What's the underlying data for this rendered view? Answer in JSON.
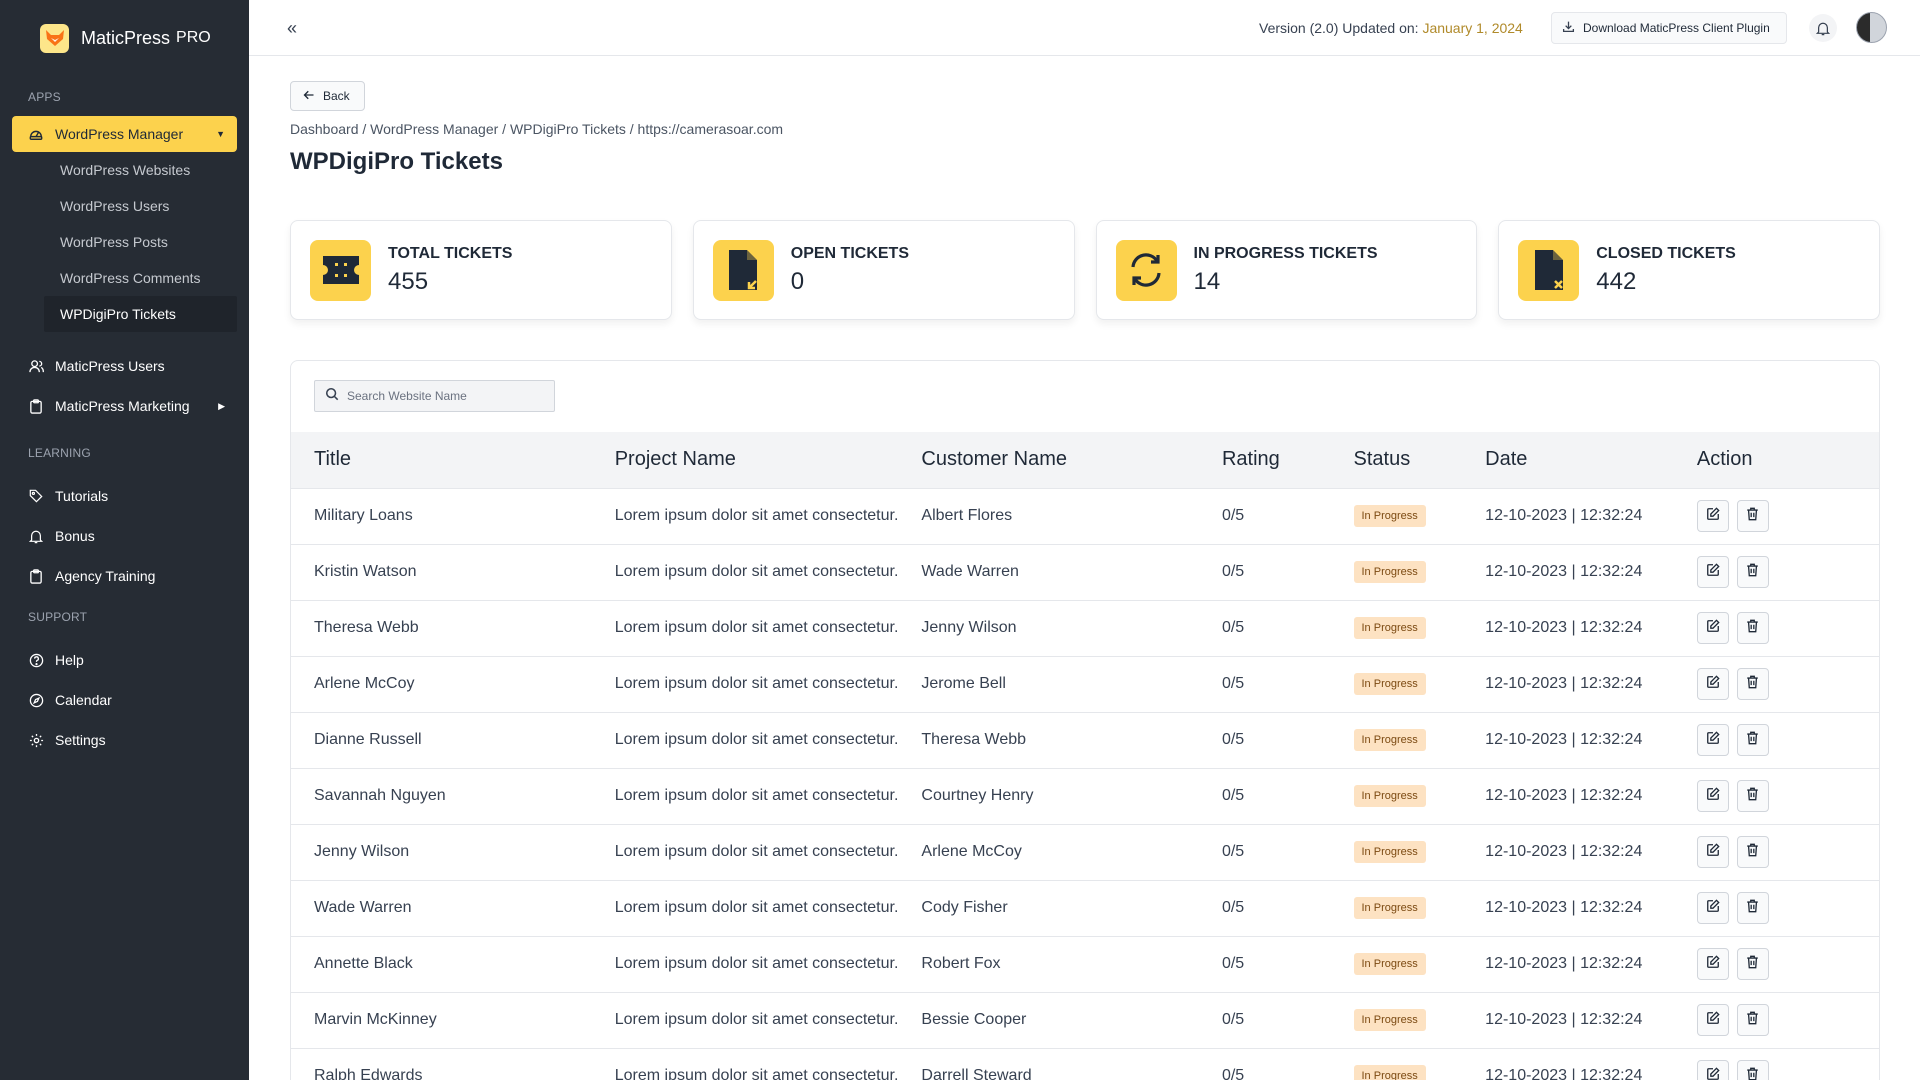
{
  "brand": {
    "name": "MaticPress",
    "suffix": "PRO"
  },
  "sidebar": {
    "sections": {
      "apps": "APPS",
      "learning": "LEARNING",
      "support": "SUPPORT"
    },
    "wordpress_manager": {
      "label": "WordPress Manager",
      "children": [
        "WordPress Websites",
        "WordPress Users",
        "WordPress Posts",
        "WordPress Comments",
        "WPDigiPro Tickets"
      ]
    },
    "maticpress_users": "MaticPress Users",
    "maticpress_marketing": "MaticPress Marketing",
    "tutorials": "Tutorials",
    "bonus": "Bonus",
    "agency_training": "Agency Training",
    "help": "Help",
    "calendar": "Calendar",
    "settings": "Settings"
  },
  "topbar": {
    "version_prefix": "Version (2.0) Updated on:",
    "version_date": "January 1, 2024",
    "download_label": "Download MaticPress Client Plugin"
  },
  "page": {
    "back_label": "Back",
    "breadcrumb": "Dashboard / WordPress Manager / WPDigiPro Tickets / https://camerasoar.com",
    "title": "WPDigiPro Tickets"
  },
  "stats": [
    {
      "label": "TOTAL TICKETS",
      "value": "455",
      "icon": "ticket-icon"
    },
    {
      "label": "OPEN TICKETS",
      "value": "0",
      "icon": "file-arrow-icon"
    },
    {
      "label": "IN PROGRESS TICKETS",
      "value": "14",
      "icon": "refresh-icon"
    },
    {
      "label": "CLOSED TICKETS",
      "value": "442",
      "icon": "file-close-icon"
    }
  ],
  "search": {
    "placeholder": "Search Website Name"
  },
  "table": {
    "columns": [
      "Title",
      "Project Name",
      "Customer Name",
      "Rating",
      "Status",
      "Date",
      "Action"
    ],
    "rows": [
      {
        "title": "Military Loans",
        "project": "Lorem ipsum dolor sit amet consectetur.",
        "customer": "Albert Flores",
        "rating": "0/5",
        "status": "In Progress",
        "date": "12-10-2023 | 12:32:24"
      },
      {
        "title": "Kristin Watson",
        "project": "Lorem ipsum dolor sit amet consectetur.",
        "customer": "Wade Warren",
        "rating": "0/5",
        "status": "In Progress",
        "date": "12-10-2023 | 12:32:24"
      },
      {
        "title": "Theresa Webb",
        "project": "Lorem ipsum dolor sit amet consectetur.",
        "customer": "Jenny Wilson",
        "rating": "0/5",
        "status": "In Progress",
        "date": "12-10-2023 | 12:32:24"
      },
      {
        "title": "Arlene McCoy",
        "project": "Lorem ipsum dolor sit amet consectetur.",
        "customer": "Jerome Bell",
        "rating": "0/5",
        "status": "In Progress",
        "date": "12-10-2023 | 12:32:24"
      },
      {
        "title": "Dianne Russell",
        "project": "Lorem ipsum dolor sit amet consectetur.",
        "customer": "Theresa Webb",
        "rating": "0/5",
        "status": "In Progress",
        "date": "12-10-2023 | 12:32:24"
      },
      {
        "title": "Savannah Nguyen",
        "project": "Lorem ipsum dolor sit amet consectetur.",
        "customer": "Courtney Henry",
        "rating": "0/5",
        "status": "In Progress",
        "date": "12-10-2023 | 12:32:24"
      },
      {
        "title": "Jenny Wilson",
        "project": "Lorem ipsum dolor sit amet consectetur.",
        "customer": "Arlene McCoy",
        "rating": "0/5",
        "status": "In Progress",
        "date": "12-10-2023 | 12:32:24"
      },
      {
        "title": "Wade Warren",
        "project": "Lorem ipsum dolor sit amet consectetur.",
        "customer": "Cody Fisher",
        "rating": "0/5",
        "status": "In Progress",
        "date": "12-10-2023 | 12:32:24"
      },
      {
        "title": "Annette Black",
        "project": "Lorem ipsum dolor sit amet consectetur.",
        "customer": "Robert Fox",
        "rating": "0/5",
        "status": "In Progress",
        "date": "12-10-2023 | 12:32:24"
      },
      {
        "title": "Marvin McKinney",
        "project": "Lorem ipsum dolor sit amet consectetur.",
        "customer": "Bessie Cooper",
        "rating": "0/5",
        "status": "In Progress",
        "date": "12-10-2023 | 12:32:24"
      },
      {
        "title": "Ralph Edwards",
        "project": "Lorem ipsum dolor sit amet consectetur.",
        "customer": "Darrell Steward",
        "rating": "0/5",
        "status": "In Progress",
        "date": "12-10-2023 | 12:32:24"
      }
    ]
  },
  "colors": {
    "sidebar_bg": "#262c34",
    "accent": "#fcd24d",
    "badge_bg": "#fde2c2"
  }
}
